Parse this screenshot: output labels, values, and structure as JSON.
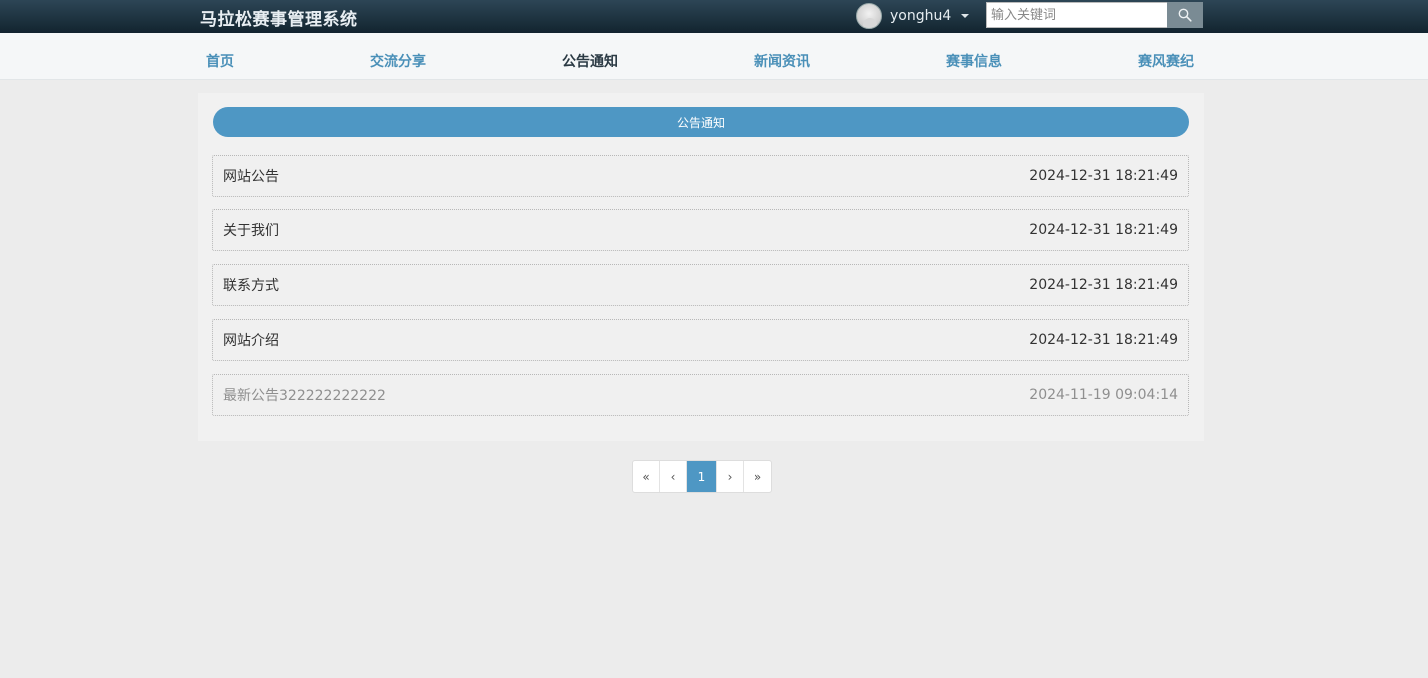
{
  "header": {
    "site_title": "马拉松赛事管理系统",
    "username": "yonghu4",
    "search_placeholder": "输入关键词"
  },
  "nav": [
    {
      "label": "首页",
      "active": false
    },
    {
      "label": "交流分享",
      "active": false
    },
    {
      "label": "公告通知",
      "active": true
    },
    {
      "label": "新闻资讯",
      "active": false
    },
    {
      "label": "赛事信息",
      "active": false
    },
    {
      "label": "赛风赛纪",
      "active": false
    }
  ],
  "section": {
    "heading": "公告通知"
  },
  "notices": [
    {
      "title": "网站公告",
      "date": "2024-12-31 18:21:49"
    },
    {
      "title": "关于我们",
      "date": "2024-12-31 18:21:49"
    },
    {
      "title": "联系方式",
      "date": "2024-12-31 18:21:49"
    },
    {
      "title": "网站介绍",
      "date": "2024-12-31 18:21:49"
    },
    {
      "title": "最新公告322222222222",
      "date": "2024-11-19 09:04:14"
    }
  ],
  "pagination": {
    "first": "«",
    "prev": "‹",
    "current": "1",
    "next": "›",
    "last": "»"
  },
  "colors": {
    "accent": "#4e97c4",
    "nav_link": "#4a90b8",
    "topbar": "#1b2f3c"
  },
  "icons": {
    "search": "search-icon",
    "user": "avatar",
    "dropdown": "caret-down-icon"
  }
}
